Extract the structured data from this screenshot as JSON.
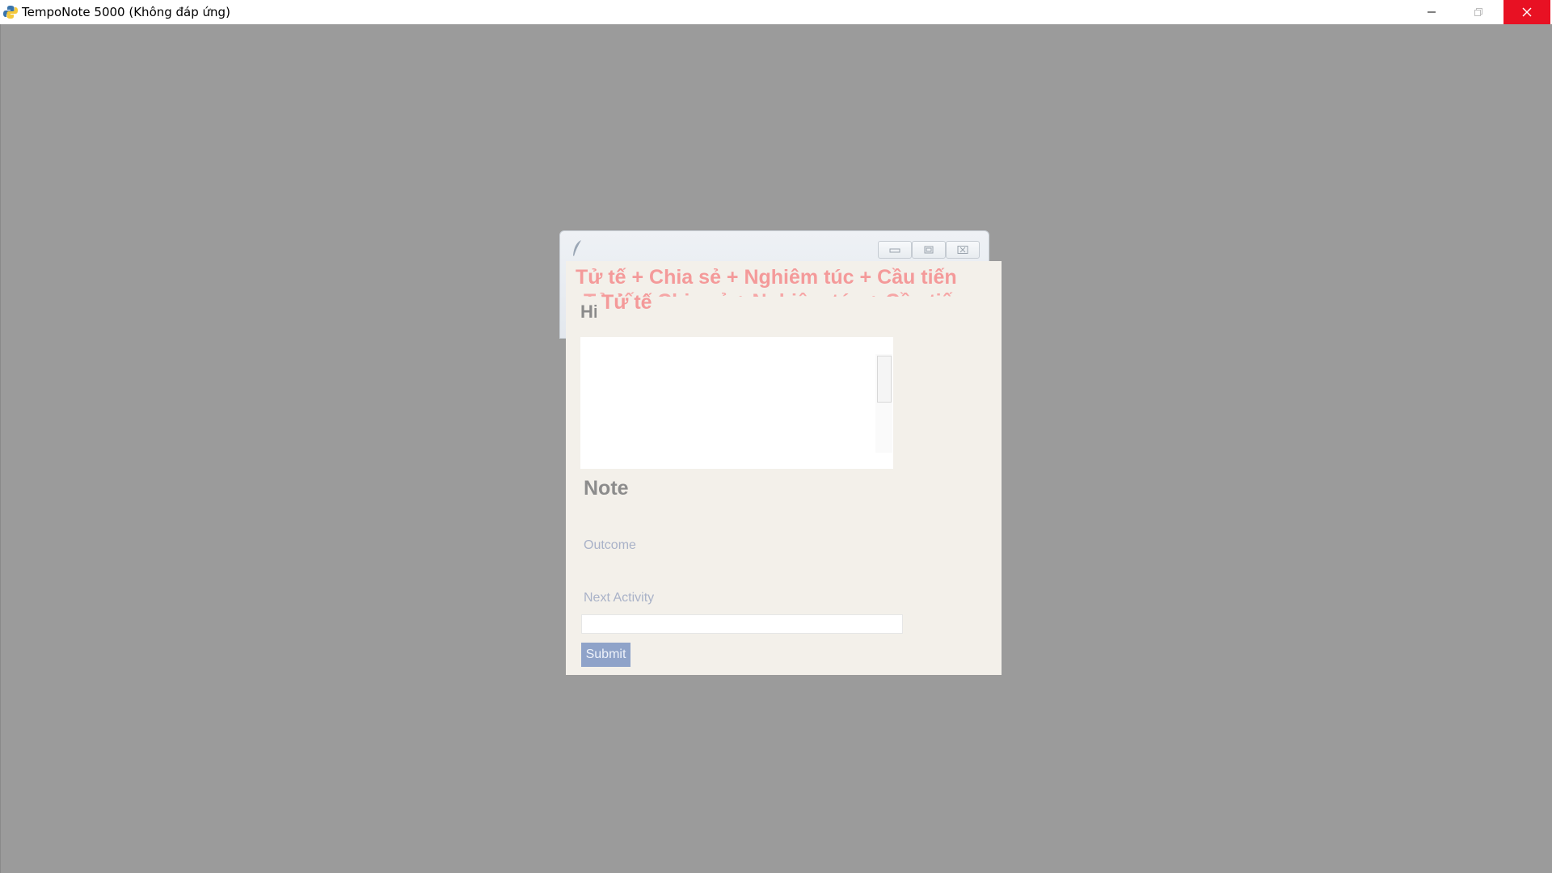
{
  "window": {
    "title": "TempoNote 5000 (Không đáp ứng)",
    "controls": {
      "minimize_icon": "minimize-icon",
      "maximize_icon": "restore-icon",
      "close_icon": "close-icon"
    },
    "close_color": "#e81123"
  },
  "dialog": {
    "icon": "feather-icon",
    "banner": {
      "line1": "Tử tế + Chia sẻ + Nghiêm túc + Cầu tiến",
      "line2": "Tử tế + Chia sẻ + Nghiêm túc + Cầu tiến",
      "line3": "Tử tế",
      "color": "#f49a9a"
    },
    "partial_label": "Hi",
    "note_heading": "Note",
    "outcome_label": "Outcome",
    "next_activity_label": "Next Activity",
    "next_activity_value": "",
    "submit_label": "Submit",
    "submit_color": "#8fa3c9"
  }
}
